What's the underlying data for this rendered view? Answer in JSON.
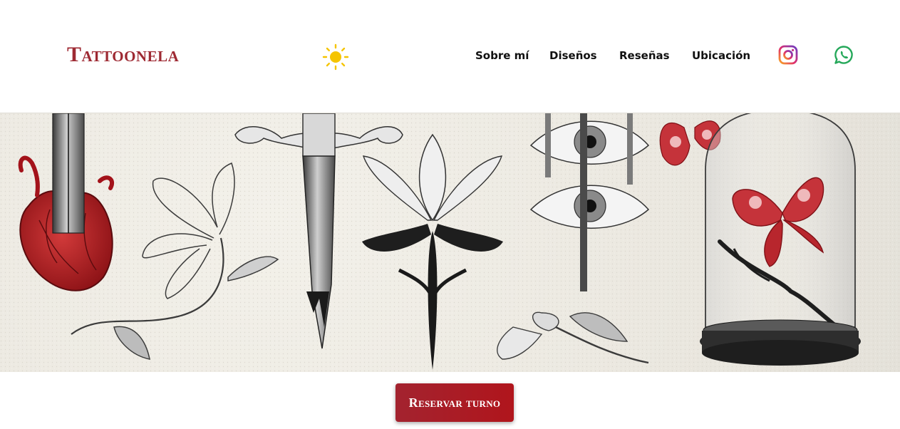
{
  "brand": {
    "name": "Tattoonela",
    "color": "#9e2a33"
  },
  "theme_toggle": {
    "icon": "sun-icon",
    "color": "#f5c400"
  },
  "nav": {
    "items": [
      {
        "label": "Sobre mí"
      },
      {
        "label": "Diseños"
      },
      {
        "label": "Reseñas"
      },
      {
        "label": "Ubicación"
      }
    ],
    "social": [
      {
        "icon": "instagram-icon"
      },
      {
        "icon": "whatsapp-icon",
        "color": "#25a85a"
      }
    ]
  },
  "hero": {
    "illustrations": [
      "anatomical-heart",
      "sword",
      "lily-flower",
      "ornamental-sword",
      "lotus-ornament",
      "eyes",
      "butterfly-skulls",
      "bell-jar-butterfly",
      "branch-flowers"
    ]
  },
  "cta": {
    "label": "Reservar turno",
    "color": "#a3232f"
  }
}
